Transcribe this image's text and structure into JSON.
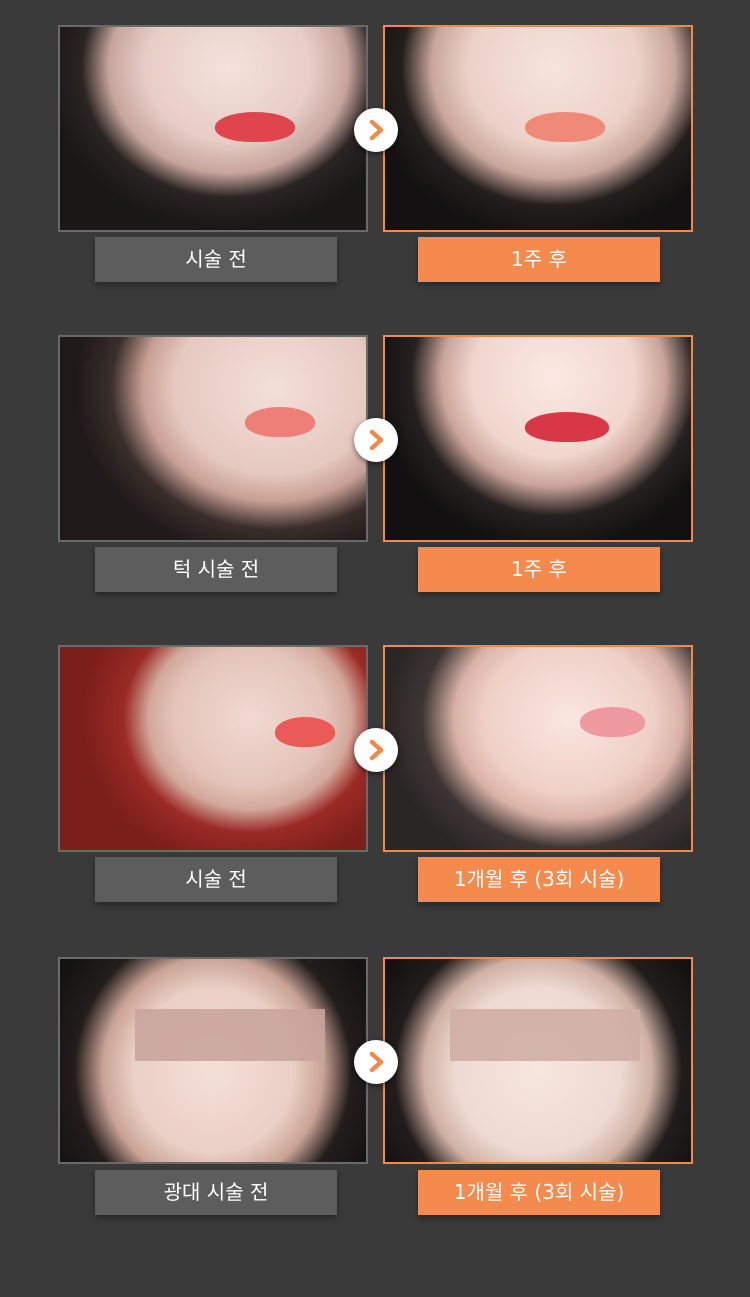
{
  "rows": [
    {
      "before_label": "시술 전",
      "after_label": "1주 후"
    },
    {
      "before_label": "턱 시술 전",
      "after_label": "1주 후"
    },
    {
      "before_label": "시술 전",
      "after_label": "1개월 후 (3회 시술)"
    },
    {
      "before_label": "광대 시술 전",
      "after_label": "1개월 후 (3회 시술)"
    }
  ],
  "colors": {
    "background": "#3a3a3a",
    "before_caption": "#5d5d5d",
    "after_caption": "#f58a4e",
    "after_border": "#f08a4b",
    "arrow_icon": "#f08a4b"
  },
  "icons": {
    "arrow": "chevron-right-icon"
  }
}
